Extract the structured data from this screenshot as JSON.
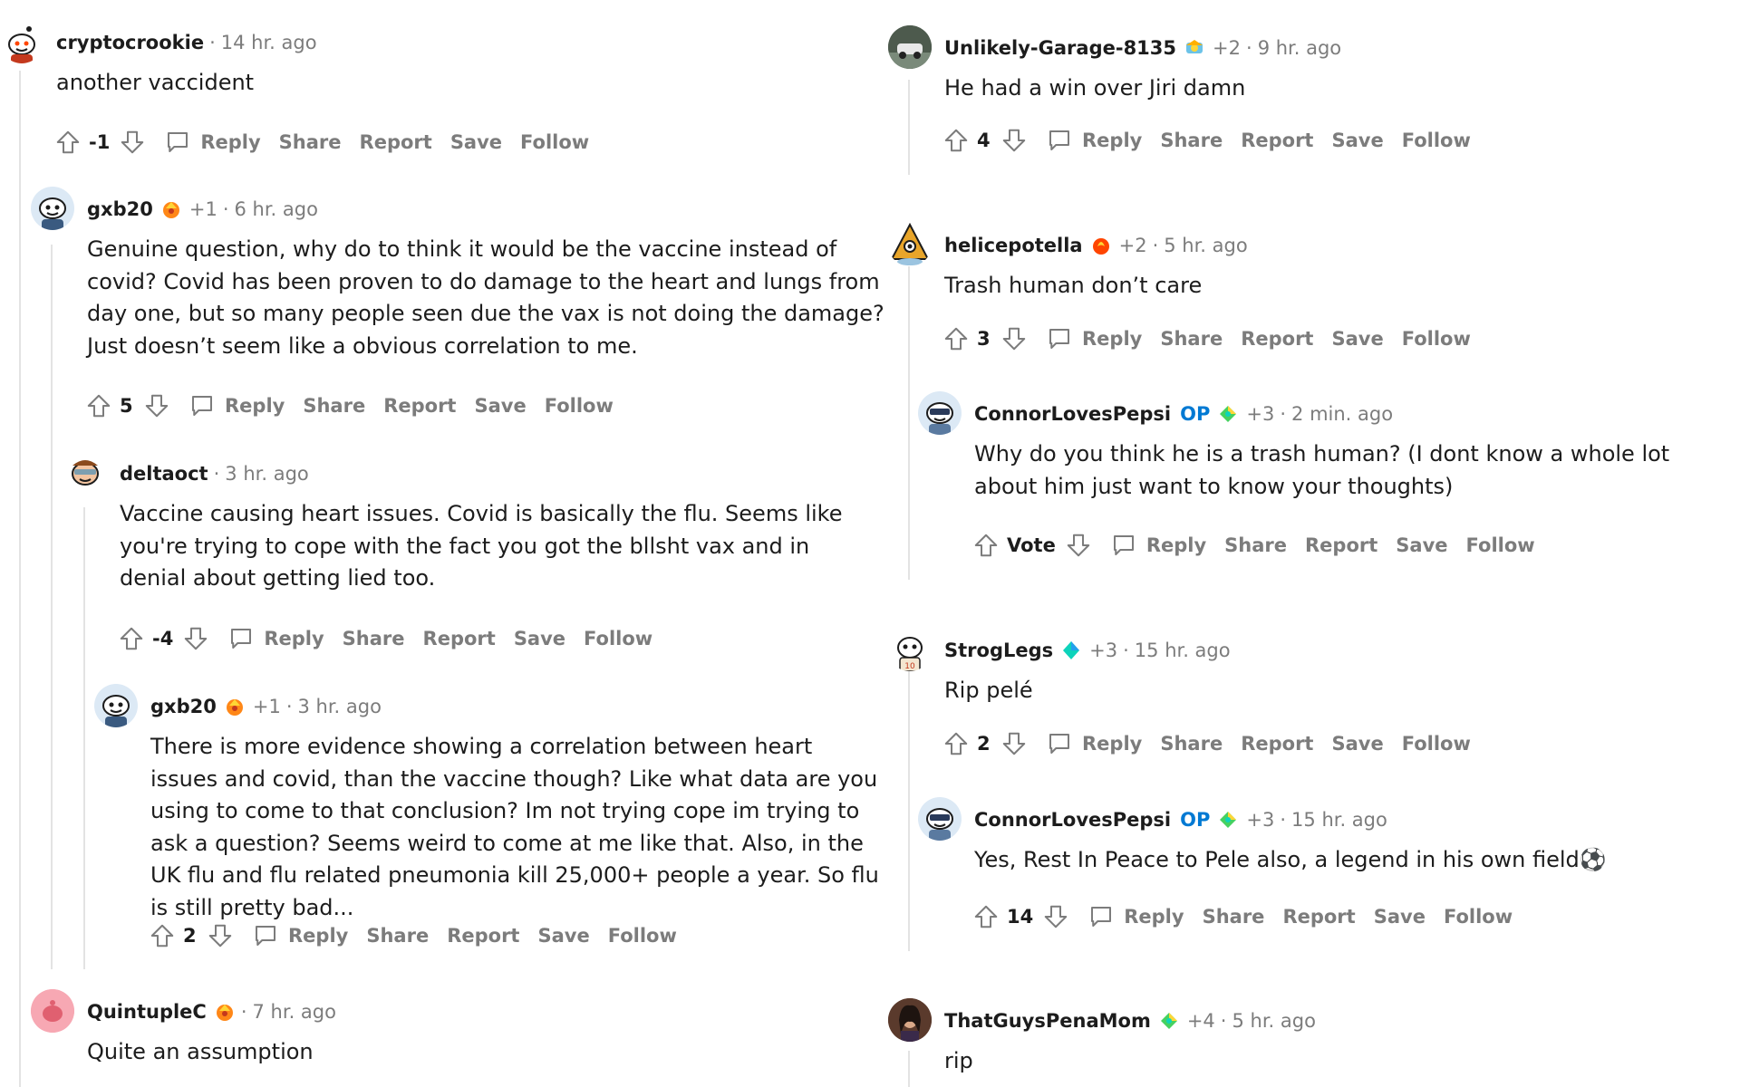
{
  "labels": {
    "reply": "Reply",
    "share": "Share",
    "report": "Report",
    "save": "Save",
    "follow": "Follow",
    "separator": "·",
    "op": "OP"
  },
  "colors": {
    "op_blue": "#0079d3",
    "meta_gray": "#7c7c7c",
    "line_gray": "#e3e3e3"
  },
  "icons": {
    "upvote": "arrow-up-outline-icon",
    "downvote": "arrow-down-outline-icon",
    "reply": "speech-bubble-icon"
  },
  "comments": [
    {
      "author": "cryptocrookie",
      "time": "14 hr. ago",
      "body": "another vaccident",
      "score": "-1",
      "avatar": "snoo-avatar"
    },
    {
      "author": "gxb20",
      "plus": "+1",
      "time": "6 hr. ago",
      "flair": "award-icon",
      "body": "Genuine question, why do to think it would be the vaccine instead of covid? Covid has been proven to do damage to the heart and lungs from day one, but so many people seen due the vax is not doing the damage? Just doesn’t seem like a obvious correlation to me.",
      "score": "5",
      "avatar": "snoo-avatar"
    },
    {
      "author": "deltaoct",
      "time": "3 hr. ago",
      "body": "Vaccine causing heart issues. Covid is basically the flu. Seems like you're trying to cope with the fact you got the bllsht vax and in denial about getting lied too.",
      "score": "-4",
      "avatar": "snoo-avatar"
    },
    {
      "author": "gxb20",
      "plus": "+1",
      "time": "3 hr. ago",
      "flair": "award-icon",
      "body": "There is more evidence showing a correlation between heart issues and covid, than the vaccine though? Like what data are you using to come to that conclusion? Im not trying cope im trying to ask a question? Seems weird to come at me like that. Also, in the UK flu and flu related pneumonia kill 25,000+ people a year. So flu is still pretty bad...",
      "score": "2",
      "avatar": "snoo-avatar"
    },
    {
      "author": "QuintupleC",
      "time": "7 hr. ago",
      "flair": "award-icon",
      "body": "Quite an assumption",
      "avatar": "default-avatar"
    },
    {
      "author": "Unlikely-Garage-8135",
      "plus": "+2",
      "time": "9 hr. ago",
      "flair": "award-icon",
      "body": "He had a win over Jiri damn",
      "score": "4",
      "avatar": "photo-avatar"
    },
    {
      "author": "helicepotella",
      "plus": "+2",
      "time": "5 hr. ago",
      "flair": "award-icon",
      "body": "Trash human don’t care",
      "score": "3",
      "avatar": "snoo-avatar"
    },
    {
      "author": "ConnorLovesPepsi",
      "op": true,
      "plus": "+3",
      "time": "2 min. ago",
      "flair": "award-icon",
      "body": "Why do you think he is a trash human? (I dont know a whole lot about him just want to know your thoughts)",
      "score": "Vote",
      "avatar": "snoo-avatar"
    },
    {
      "author": "StrogLegs",
      "plus": "+3",
      "time": "15 hr. ago",
      "flair": "award-icon",
      "body": "Rip pelé",
      "score": "2",
      "avatar": "snoo-avatar"
    },
    {
      "author": "ConnorLovesPepsi",
      "op": true,
      "plus": "+3",
      "time": "15 hr. ago",
      "flair": "award-icon",
      "body": "Yes, Rest In Peace to Pele also, a legend in his own field⚽",
      "score": "14",
      "avatar": "snoo-avatar"
    },
    {
      "author": "ThatGuysPenaMom",
      "plus": "+4",
      "time": "5 hr. ago",
      "flair": "award-icon",
      "body": "rip",
      "avatar": "photo-avatar"
    }
  ]
}
